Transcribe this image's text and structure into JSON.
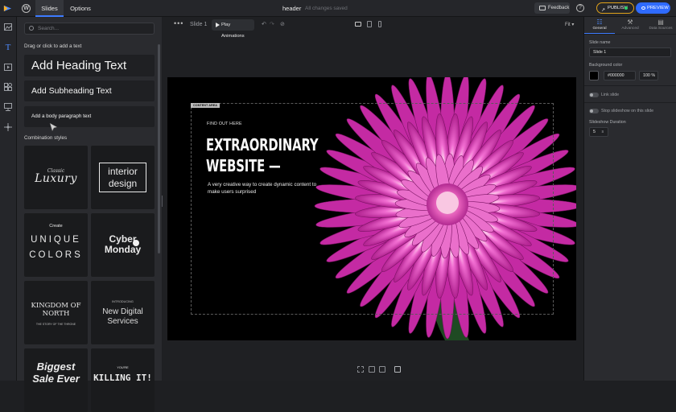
{
  "topbar": {
    "tabs": [
      {
        "label": "Slides"
      },
      {
        "label": "Options"
      }
    ],
    "doc_title": "header",
    "doc_status": "All changes saved",
    "feedback_label": "Feedback",
    "help_label": "?",
    "publish_label": "PUBLISH",
    "preview_label": "PREVIEW",
    "colors": {
      "accent": "#2f6bff",
      "publish_border": "#e0a21b",
      "status_dot": "#2fd06b"
    }
  },
  "icon_rail": {
    "items": [
      {
        "icon": "image-icon"
      },
      {
        "icon": "text-icon",
        "glyph": "T"
      },
      {
        "icon": "video-icon"
      },
      {
        "icon": "elements-icon"
      },
      {
        "icon": "embed-icon"
      },
      {
        "icon": "move-icon"
      }
    ]
  },
  "left_panel": {
    "search_placeholder": "Search...",
    "hint": "Drag or click to add a text",
    "text_cards": {
      "heading": "Add Heading Text",
      "subheading": "Add Subheading Text",
      "paragraph": "Add a body paragraph text"
    },
    "combination_label": "Combination styles",
    "combos": [
      {
        "line1": "Classic",
        "line2": "Luxury"
      },
      {
        "line1": "interior",
        "line2": "design"
      },
      {
        "line1": "Create",
        "line2": "UNIQUE",
        "line3": "COLORS"
      },
      {
        "line1": "Cyber",
        "line2": "Monday"
      },
      {
        "line1": "KINGDOM OF",
        "line2": "NORTH",
        "line3": "THE STORY OF THE THRONE"
      },
      {
        "line1": "INTRODUCING",
        "line2": "New Digital",
        "line3": "Services"
      },
      {
        "line1": "Biggest",
        "line2": "Sale Ever"
      },
      {
        "line1": "YOU'RE",
        "line2": "KILLING IT!"
      }
    ]
  },
  "canvas_toolbar": {
    "more": "•••",
    "slide_name": "Slide 1",
    "play_label": "Play Animations",
    "fit_label": "Fit ▾"
  },
  "slide": {
    "content_area_tag": "CONTENT AREA",
    "kicker": "FIND OUT HERE",
    "headline_line1": "EXTRAORDINARY",
    "headline_line2": "WEBSITE —",
    "description": "A very creative way to create dynamic content to make users surprised",
    "background": "#000000",
    "flower_color": "#d63fb8"
  },
  "right_panel": {
    "tabs": [
      {
        "label": "General"
      },
      {
        "label": "Advanced"
      },
      {
        "label": "Data Sources"
      }
    ],
    "slide_name_label": "Slide name",
    "slide_name_value": "Slide 1",
    "background_color_label": "Background color",
    "background_color_value": "#000000",
    "opacity_value": "100",
    "opacity_unit": "%",
    "link_slide_label": "Link slide",
    "stop_slideshow_label": "Stop slideshow on this slide",
    "duration_label": "Slideshow Duration",
    "duration_value": "5",
    "duration_unit": "s"
  }
}
